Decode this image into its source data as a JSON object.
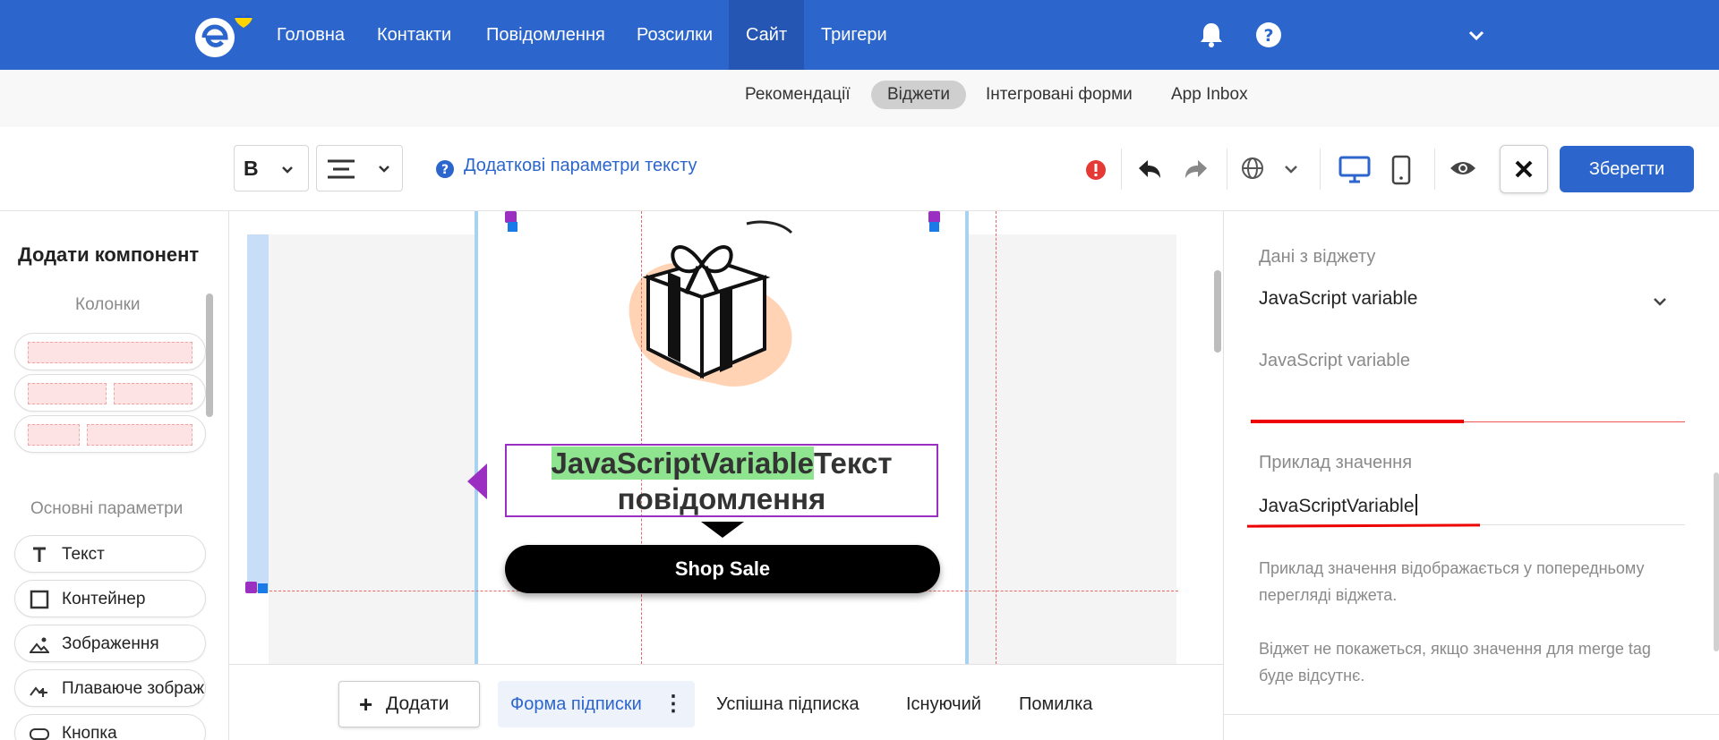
{
  "nav": {
    "items": [
      "Головна",
      "Контакти",
      "Повідомлення",
      "Розсилки",
      "Сайт",
      "Тригери"
    ],
    "active_index": 4
  },
  "subnav": {
    "items": [
      "Рекомендації",
      "Віджети",
      "Інтегровані форми",
      "App Inbox"
    ],
    "active_index": 1
  },
  "toolbar": {
    "bold_label": "B",
    "text_params_label": "Додаткові параметри тексту",
    "save_label": "Зберегти"
  },
  "left_panel": {
    "title": "Додати компонент",
    "columns_heading": "Колонки",
    "basic_heading": "Основні параметри",
    "components": [
      {
        "label": "Текст",
        "icon": "text-icon"
      },
      {
        "label": "Контейнер",
        "icon": "container-icon"
      },
      {
        "label": "Зображення",
        "icon": "image-icon"
      },
      {
        "label": "Плаваюче зображення",
        "icon": "floating-image-icon"
      },
      {
        "label": "Кнопка",
        "icon": "button-icon"
      }
    ]
  },
  "canvas": {
    "text_highlight": "JavaScriptVariable",
    "text_line1_rest": "Текст",
    "text_line2": "повідомлення",
    "button_label": "Shop Sale"
  },
  "bottom_tabs": {
    "add_label": "Додати",
    "tabs": [
      "Форма підписки",
      "Успішна підписка",
      "Існуючий",
      "Помилка"
    ],
    "active_index": 0
  },
  "right_panel": {
    "widget_data_label": "Дані з віджету",
    "widget_data_value": "JavaScript variable",
    "js_variable_label": "JavaScript variable",
    "js_variable_value": "",
    "example_label": "Приклад значення",
    "example_value": "JavaScriptVariable",
    "help_text_1": "Приклад значення відображається у попередньому перегляді віджета.",
    "help_text_2": "Віджет не покажеться, якщо значення для merge tag буде відсутнє."
  },
  "colors": {
    "brand_blue": "#2c66cd",
    "selection_purple": "#9b2fc2",
    "highlight_green": "#8fe58f",
    "error_red": "#e53935"
  }
}
